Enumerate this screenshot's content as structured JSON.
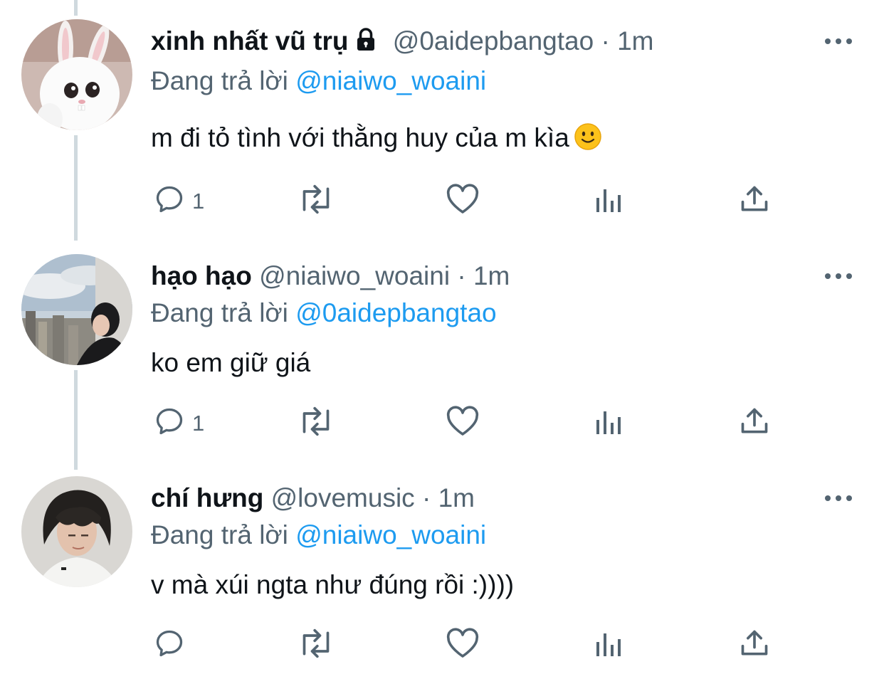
{
  "tweets": [
    {
      "name": "xinh nhất vũ trụ",
      "locked": true,
      "handle": "@0aidepbangtao",
      "time": "· 1m",
      "reply_prefix": "Đang trả lời",
      "reply_to": "@niaiwo_woaini",
      "text": "m đi tỏ tình với thằng huy của m kìa",
      "emoji": "slightly-smiling-face-icon",
      "reply_count": "1"
    },
    {
      "name": "hạo hạo",
      "locked": false,
      "handle": "@niaiwo_woaini",
      "time": "· 1m",
      "reply_prefix": "Đang trả lời",
      "reply_to": "@0aidepbangtao",
      "text": "ko em giữ giá",
      "reply_count": "1"
    },
    {
      "name": "chí hưng",
      "locked": false,
      "handle": "@lovemusic",
      "time": "· 1m",
      "reply_prefix": "Đang trả lời",
      "reply_to": "@niaiwo_woaini",
      "text": "v mà xúi ngta như đúng rồi :))))",
      "reply_count": ""
    }
  ],
  "colors": {
    "text": "#0f1419",
    "secondary": "#536471",
    "link": "#1d9bf0",
    "thread_line": "#cfd9de"
  }
}
